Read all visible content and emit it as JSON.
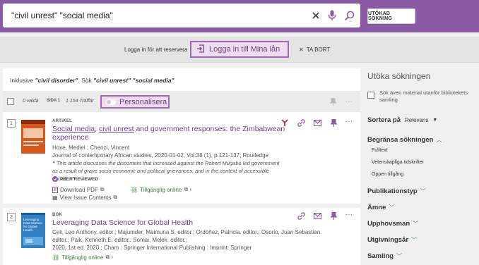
{
  "search": {
    "query": "\"civil unrest\" \"social media\"",
    "advanced_label": "UTÖKAD SÖKNING"
  },
  "login": {
    "prompt": "Logga in för att reservera",
    "button_label": "Logga in till Mina lån",
    "dismiss_label": "TA BORT"
  },
  "results": {
    "inkl_prefix": "Inklusive ",
    "inkl_term": "\"civil disorder\"",
    "inkl_mid": ". Sök ",
    "inkl_query": "\"civil unrest\" \"social media\"",
    "selected": "0 valda",
    "page": "SIDA 1",
    "hits": "1 154 Träffar",
    "personalize_label": "Personalisera"
  },
  "records": [
    {
      "num": "1",
      "type": "ARTIKEL",
      "title_a": "Social media",
      "title_b": ", ",
      "title_c": "civil unrest",
      "title_d": " and government responses: the Zimbabwean",
      "title_e": "experience",
      "authors": "Hove, Mediel ; Chenzi, Vincent",
      "source": "Journal of contemporary African studies, 2020-01-02, Vol.38 (1), p.121-137; Routledge",
      "abstract": "This article discusses the discontent that increased against the Robert Mugabe led government as a result of grave socio-economic and political grievances, and in the context of accessible social...",
      "peer": "PEER REVIEWED",
      "pdf": "Download PDF",
      "online": "Tillgänglig online",
      "issue": "View Issue Contents"
    },
    {
      "num": "2",
      "type": "BOK",
      "title": "Leveraging Data Science for Global Health",
      "line1": "Celi, Leo Anthony. editor.; Majumder, Maimuna S. editor.; Ordóñez, Patricia. editor.; Osorio, Juan Sebastian.",
      "line2": "editor.; Paik, Kenneth E. editor.; Somai, Melek. editor.;",
      "line3": "2020; 1st ed. 2020.; Cham : Springer International Publishing : Imprint: Springer",
      "online": "Tillgänglig online",
      "cover_text": "Leveraging Data Science for Global Health"
    }
  ],
  "sidebar": {
    "heading": "Utöka sökningen",
    "outside_option": "Sök även material utanför bibliotekets samling",
    "sort_label": "Sortera på",
    "sort_value": "Relevans",
    "limit_label": "Begränsa sökningen",
    "limit_items": [
      "Fulltext",
      "Vetenskapliga tidskrifter",
      "Öppen tillgång"
    ],
    "facets": [
      "Publikationstyp",
      "Ämne",
      "Upphovsman",
      "Utgivningsår",
      "Samling"
    ]
  },
  "colors": {
    "header": "#8a5aa5",
    "accent": "#6d3f8a",
    "online": "#3c7e3c"
  }
}
